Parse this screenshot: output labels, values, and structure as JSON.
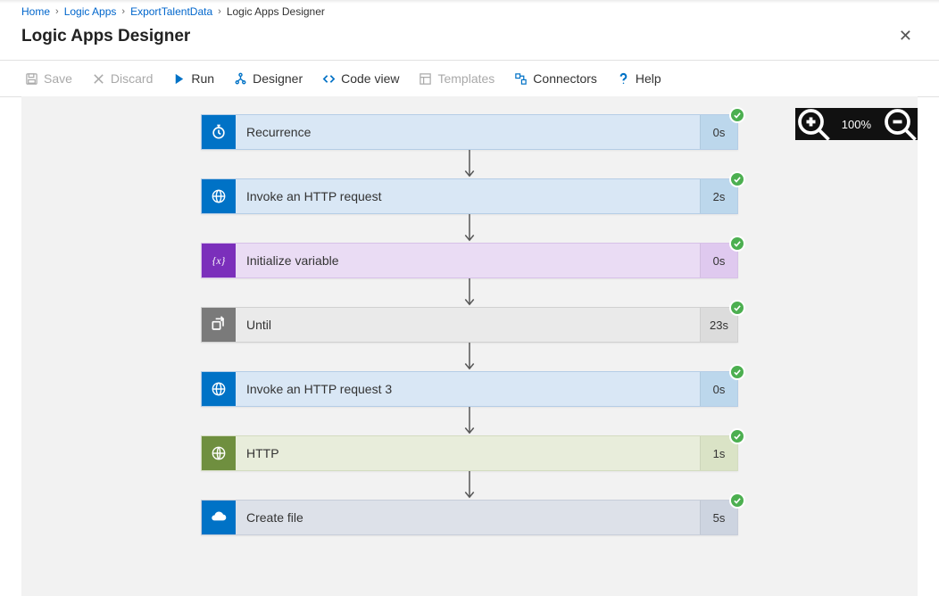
{
  "breadcrumbs": {
    "home": "Home",
    "logic_apps": "Logic Apps",
    "resource": "ExportTalentData",
    "current": "Logic Apps Designer"
  },
  "header": {
    "title": "Logic Apps Designer"
  },
  "toolbar": {
    "save": "Save",
    "discard": "Discard",
    "run": "Run",
    "designer": "Designer",
    "code_view": "Code view",
    "templates": "Templates",
    "connectors": "Connectors",
    "help": "Help"
  },
  "zoom": {
    "level": "100%"
  },
  "nodes": [
    {
      "id": "recurrence",
      "title": "Recurrence",
      "time": "0s",
      "icon": "clock",
      "theme": "blue",
      "status": "success"
    },
    {
      "id": "http1",
      "title": "Invoke an HTTP request",
      "time": "2s",
      "icon": "globe",
      "theme": "blue",
      "status": "success"
    },
    {
      "id": "initvar",
      "title": "Initialize variable",
      "time": "0s",
      "icon": "variable",
      "theme": "purple",
      "status": "success"
    },
    {
      "id": "until",
      "title": "Until",
      "time": "23s",
      "icon": "loop",
      "theme": "grey",
      "status": "success"
    },
    {
      "id": "http3",
      "title": "Invoke an HTTP request 3",
      "time": "0s",
      "icon": "globe",
      "theme": "blue",
      "status": "success"
    },
    {
      "id": "http",
      "title": "HTTP",
      "time": "1s",
      "icon": "globe2",
      "theme": "green",
      "status": "success"
    },
    {
      "id": "createfile",
      "title": "Create file",
      "time": "5s",
      "icon": "cloud",
      "theme": "slate",
      "status": "success"
    }
  ]
}
